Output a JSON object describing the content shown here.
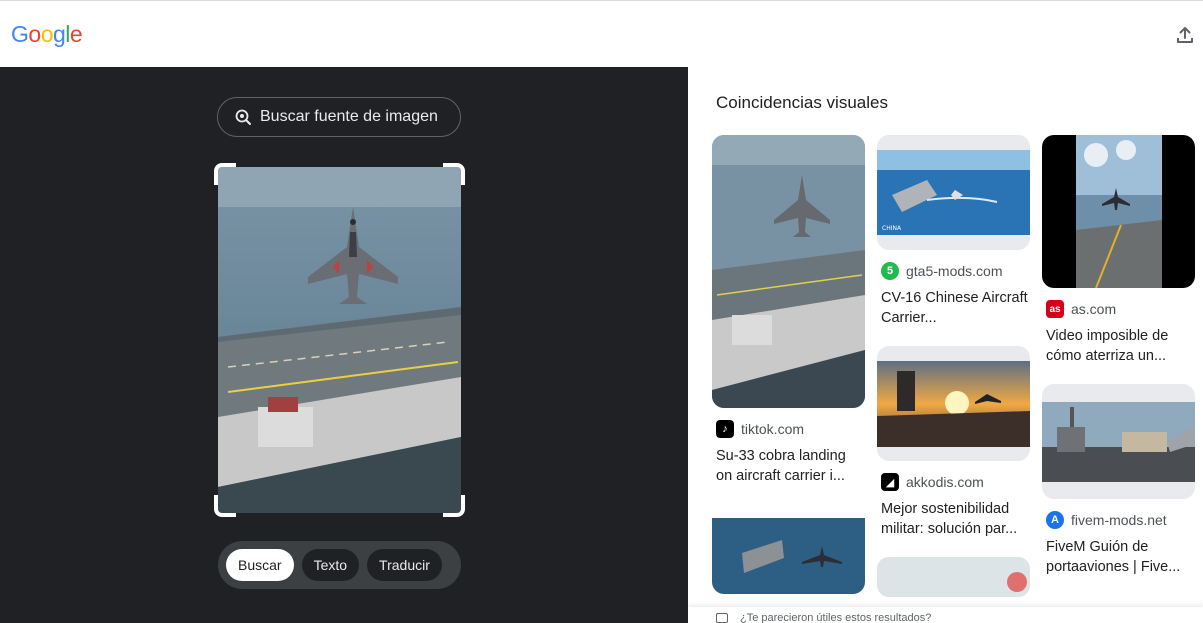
{
  "header": {
    "logo_letters": [
      {
        "ch": "G",
        "color": "#4285F4"
      },
      {
        "ch": "o",
        "color": "#EA4335"
      },
      {
        "ch": "o",
        "color": "#FBBC05"
      },
      {
        "ch": "g",
        "color": "#4285F4"
      },
      {
        "ch": "l",
        "color": "#34A853"
      },
      {
        "ch": "e",
        "color": "#EA4335"
      }
    ],
    "upload_icon": "upload-icon"
  },
  "left": {
    "source_button_label": "Buscar fuente de imagen",
    "modes": [
      "Buscar",
      "Texto",
      "Traducir"
    ],
    "active_mode": "Buscar"
  },
  "right": {
    "section_title": "Coincidencias visuales",
    "columns": [
      [
        {
          "thumb": "jet-carrier-tall",
          "site": "tiktok.com",
          "fav_color": "#000000",
          "fav_text": "♪",
          "title": "Su-33 cobra landing on aircraft carrier i..."
        },
        {
          "thumb": "carrier-sea-top",
          "site": "",
          "fav_color": "",
          "fav_text": "",
          "title": ""
        }
      ],
      [
        {
          "thumb": "carrier-ocean",
          "site": "gta5-mods.com",
          "fav_color": "#20ba4e",
          "fav_text": "5",
          "title": "CV-16 Chinese Aircraft Carrier..."
        },
        {
          "thumb": "carrier-sunset",
          "site": "akkodis.com",
          "fav_color": "#000000",
          "fav_text": "◢",
          "title": "Mejor sostenibilidad militar: solución par..."
        },
        {
          "thumb": "carrier-partial",
          "site": "",
          "fav_color": "",
          "fav_text": "",
          "title": ""
        }
      ],
      [
        {
          "thumb": "jet-carrier-phone",
          "site": "as.com",
          "fav_color": "#d4001a",
          "fav_text": "as",
          "title": "Video imposible de cómo aterriza un..."
        },
        {
          "thumb": "carrier-deck-helicopter",
          "site": "fivem-mods.net",
          "fav_color": "#1a73e8",
          "fav_text": "A",
          "title": "FiveM Guión de portaaviones | Five..."
        }
      ]
    ],
    "feedback_text": "¿Te parecieron útiles estos resultados?"
  }
}
